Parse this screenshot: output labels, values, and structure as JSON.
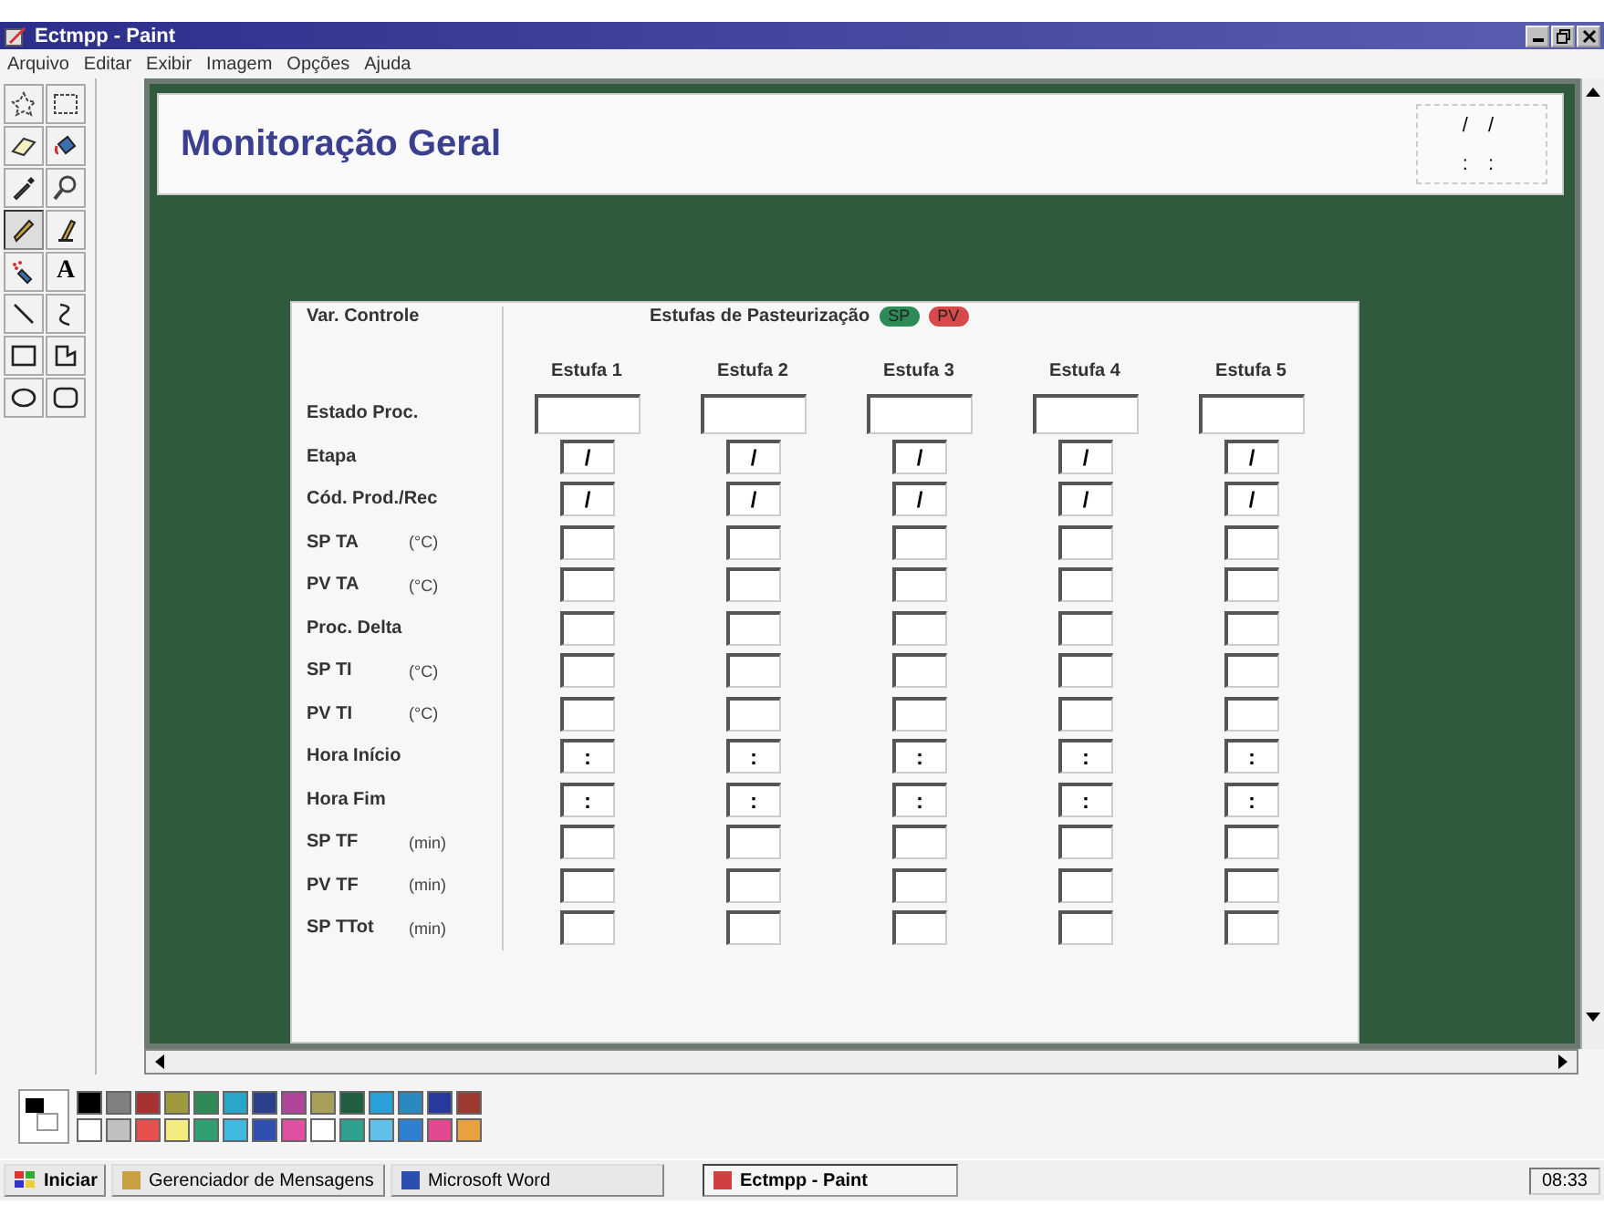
{
  "window": {
    "title": "Ectmpp - Paint"
  },
  "menu": [
    "Arquivo",
    "Editar",
    "Exibir",
    "Imagem",
    "Opções",
    "Ajuda"
  ],
  "tools": [
    {
      "kind": "free-select",
      "selected": false
    },
    {
      "kind": "select",
      "selected": false
    },
    {
      "kind": "eraser",
      "selected": false
    },
    {
      "kind": "fill",
      "selected": false
    },
    {
      "kind": "picker",
      "selected": false
    },
    {
      "kind": "magnifier",
      "selected": false
    },
    {
      "kind": "pencil",
      "selected": true
    },
    {
      "kind": "brush",
      "selected": false
    },
    {
      "kind": "airbrush",
      "selected": false
    },
    {
      "kind": "text",
      "glyph": "A",
      "selected": false
    },
    {
      "kind": "line",
      "selected": false
    },
    {
      "kind": "curve",
      "selected": false
    },
    {
      "kind": "rect",
      "selected": false
    },
    {
      "kind": "polygon",
      "selected": false
    },
    {
      "kind": "ellipse",
      "selected": false
    },
    {
      "kind": "rounded-rect",
      "selected": false
    }
  ],
  "image": {
    "title": "Monitoração Geral",
    "date": "/ /",
    "time": ": :",
    "form": {
      "corner": "Var. Controle",
      "group": "Estufas de Pasteurização",
      "legend": [
        {
          "label": "SP",
          "color": "#2e8b57"
        },
        {
          "label": "PV",
          "color": "#d84a4a"
        }
      ],
      "columns": [
        "Estufa 1",
        "Estufa 2",
        "Estufa 3",
        "Estufa 4",
        "Estufa 5"
      ],
      "rows": [
        {
          "label": "Estado Proc.",
          "kind": "wide"
        },
        {
          "label": "Etapa",
          "kind": "text",
          "cells": [
            "/",
            "/",
            "/",
            "/",
            "/"
          ]
        },
        {
          "label": "Cód. Prod./Rec",
          "kind": "text",
          "cells": [
            "/",
            "/",
            "/",
            "/",
            "/"
          ]
        },
        {
          "label": "SP TA",
          "unit": "(°C)",
          "kind": "blank"
        },
        {
          "label": "PV TA",
          "unit": "(°C)",
          "kind": "blank"
        },
        {
          "label": "Proc. Delta",
          "kind": "blank"
        },
        {
          "label": "SP TI",
          "unit": "(°C)",
          "kind": "blank"
        },
        {
          "label": "PV TI",
          "unit": "(°C)",
          "kind": "blank"
        },
        {
          "label": "Hora Início",
          "kind": "text",
          "cells": [
            ":",
            ":",
            ":",
            ":",
            ":"
          ]
        },
        {
          "label": "Hora Fim",
          "kind": "text",
          "cells": [
            ":",
            ":",
            ":",
            ":",
            ":"
          ]
        },
        {
          "label": "SP TF",
          "unit": "(min)",
          "kind": "blank"
        },
        {
          "label": "PV TF",
          "unit": "(min)",
          "kind": "blank"
        },
        {
          "label": "SP TTot",
          "unit": "(min)",
          "kind": "blank"
        }
      ]
    }
  },
  "palette": {
    "top": [
      {
        "color": "#000000"
      },
      {
        "color": "#808080"
      },
      {
        "color": "#a83232"
      },
      {
        "color": "#9c9a3c"
      },
      {
        "color": "#2e8b57"
      },
      {
        "color": "#2aa6c8"
      },
      {
        "color": "#2b3f8c"
      },
      {
        "color": "#b0449a"
      },
      {
        "color": "#a8a05a"
      },
      {
        "color": "#1f5e3e"
      },
      {
        "color": "#2aa0d8"
      },
      {
        "color": "#2a8ac0"
      },
      {
        "color": "#2a3a9c"
      },
      {
        "color": "#9c3a30"
      }
    ],
    "bottom": [
      {
        "color": "#ffffff"
      },
      {
        "color": "#c0c0c0"
      },
      {
        "color": "#e85050"
      },
      {
        "color": "#f4ec80"
      },
      {
        "color": "#30a070"
      },
      {
        "color": "#40b8e0"
      },
      {
        "color": "#3050b0"
      },
      {
        "color": "#e050a0"
      },
      {
        "color": "#ffffff"
      },
      {
        "color": "#30a090"
      },
      {
        "color": "#60c0e8"
      },
      {
        "color": "#3080d0"
      },
      {
        "color": "#e04890"
      },
      {
        "color": "#e8a040"
      }
    ]
  },
  "taskbar": {
    "start": "Iniciar",
    "tasks": [
      {
        "label": "Gerenciador de Mensagens",
        "selected": false
      },
      {
        "label": "Microsoft Word",
        "selected": false
      },
      {
        "label": "Ectmpp - Paint",
        "selected": true
      }
    ],
    "clock": "08:33"
  }
}
